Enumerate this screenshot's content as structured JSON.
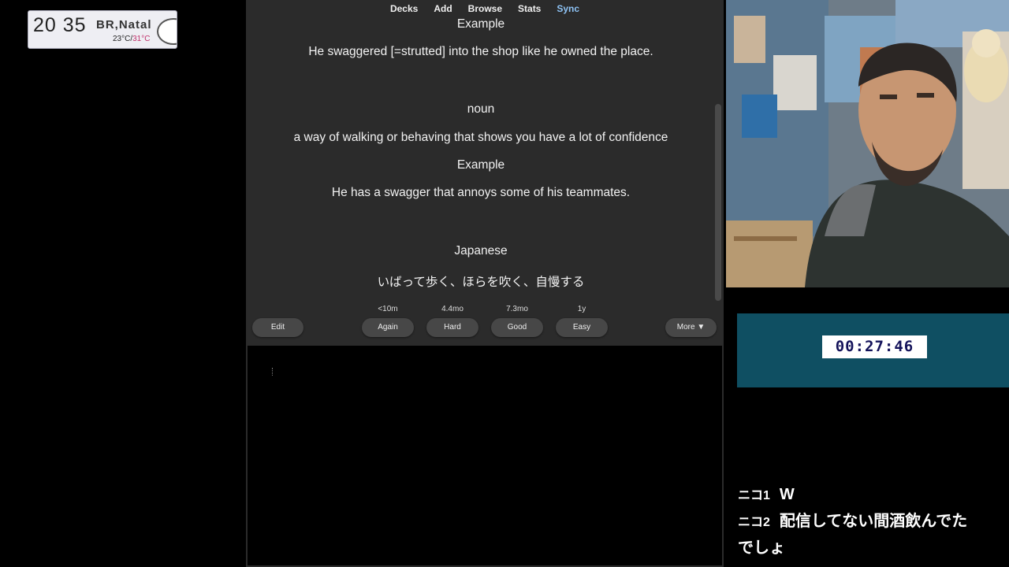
{
  "weather": {
    "time": "20 35",
    "city": "BR,Natal",
    "temp_min": "23°C/",
    "temp_max": "31°C",
    "icon": "cloud-icon"
  },
  "anki": {
    "nav": [
      "Decks",
      "Add",
      "Browse",
      "Stats",
      "Sync"
    ],
    "active_tab": "Sync",
    "card_lines": [
      "Example",
      "He swaggered [=strutted] into the shop like he owned the place.",
      "noun",
      "a way of walking or behaving that shows you have a lot of confidence",
      "Example",
      "He has a swagger that annoys some of his teammates.",
      "Japanese",
      "いばって歩く、ほらを吹く、自慢する"
    ],
    "buttons": {
      "edit": "Edit",
      "again": "Again",
      "hard": "Hard",
      "good": "Good",
      "easy": "Easy",
      "more": "More ▼"
    },
    "intervals": {
      "again": "<10m",
      "hard": "4.4mo",
      "good": "7.3mo",
      "easy": "1y"
    }
  },
  "timer": {
    "value": "00:27:46"
  },
  "comments": [
    {
      "who": "ニコ1",
      "text": "W"
    },
    {
      "who": "ニコ2",
      "text": "配信してない間酒飲んでた"
    },
    {
      "who": "",
      "text": "でしょ"
    }
  ],
  "colors": {
    "anki_bg": "#2b2b2b",
    "active_tab": "#8ec3f5",
    "timer_bg": "#0f4f62",
    "timer_text": "#13125a"
  }
}
